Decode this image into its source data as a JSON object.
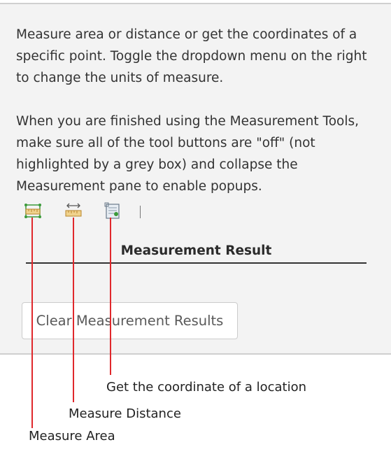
{
  "description": {
    "paragraph1": "Measure area or distance or get the coordinates of a specific point. Toggle the dropdown menu on the right to change the units of measure.",
    "paragraph2": "When you are finished using the Measurement Tools, make sure all of the tool buttons are \"off\" (not highlighted by a grey box) and collapse the Measurement pane to enable popups."
  },
  "toolbar": {
    "tools": [
      {
        "icon": "measure-area-icon"
      },
      {
        "icon": "measure-distance-icon"
      },
      {
        "icon": "location-coordinate-icon"
      }
    ]
  },
  "result": {
    "header": "Measurement Result"
  },
  "clear_button_label": "Clear Measurement Results",
  "callouts": {
    "location": "Get the coordinate of a location",
    "distance": "Measure Distance",
    "area": "Measure Area"
  },
  "colors": {
    "callout_line": "#e0282c",
    "panel_bg": "#f3f3f3",
    "ruler_fill": "#f0d28c",
    "ruler_stroke": "#b8862b",
    "area_node": "#3a9a3a"
  }
}
